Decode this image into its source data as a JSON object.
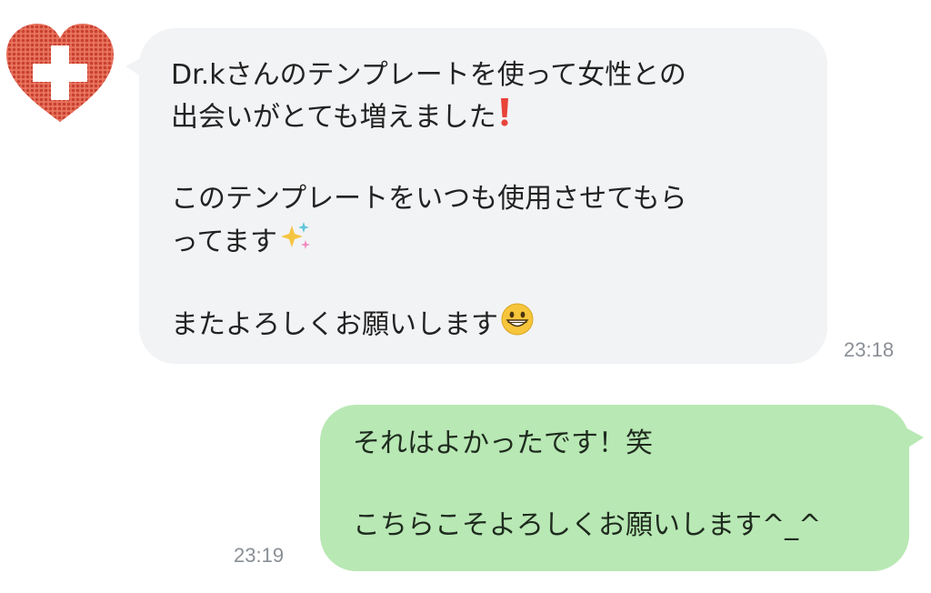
{
  "chat": {
    "incoming": {
      "avatar_icon": "heart-cross-icon",
      "lines": [
        "Dr.kさんのテンプレートを使って女性との",
        "出会いがとても増えました",
        "このテンプレートをいつも使用させてもら",
        "ってます",
        "またよろしくお願いします"
      ],
      "emojis": [
        "exclamation-icon",
        "sparkles-icon",
        "grinning-face-icon"
      ],
      "time": "23:18",
      "bubble_color": "#f2f3f5"
    },
    "outgoing": {
      "lines": [
        "それはよかったです！笑",
        "こちらこそよろしくお願いします^_^"
      ],
      "time": "23:19",
      "bubble_color": "#b8e8b4"
    }
  },
  "colors": {
    "avatar": "#e05a4a",
    "exclamation": "#e8443a",
    "time_text": "#8a8f96"
  }
}
